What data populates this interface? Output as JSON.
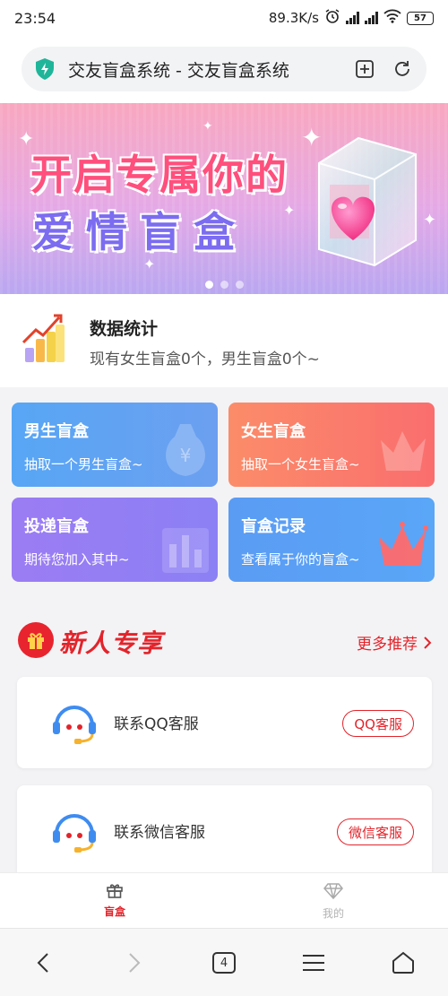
{
  "status_bar": {
    "time": "23:54",
    "net_speed": "89.3K/s",
    "battery": "57"
  },
  "browser": {
    "address_title": "交友盲盒系统 - 交友盲盒系统"
  },
  "banner": {
    "line1": "开启专属你的",
    "line2": "爱情盲盒",
    "slide_count": 3,
    "active_slide": 0
  },
  "stats": {
    "title": "数据统计",
    "summary": "现有女生盲盒0个，男生盲盒0个~"
  },
  "cards": {
    "male": {
      "title": "男生盲盒",
      "subtitle": "抽取一个男生盲盒~"
    },
    "female": {
      "title": "女生盲盒",
      "subtitle": "抽取一个女生盲盒~"
    },
    "deliver": {
      "title": "投递盲盒",
      "subtitle": "期待您加入其中~"
    },
    "record": {
      "title": "盲盒记录",
      "subtitle": "查看属于你的盲盒~"
    }
  },
  "section": {
    "title": "新人专享",
    "more_label": "更多推荐"
  },
  "services": {
    "qq": {
      "label": "联系QQ客服",
      "button": "QQ客服"
    },
    "wechat": {
      "label": "联系微信客服",
      "button": "微信客服"
    }
  },
  "tabbar": {
    "home": "盲盒",
    "mine": "我的"
  },
  "system_nav": {
    "tab_count": "4"
  },
  "colors": {
    "accent": "#e2242b",
    "male": "#57a6f5",
    "female": "#fb8c69",
    "deliver": "#9b7cf3",
    "record": "#5a9cf4"
  }
}
